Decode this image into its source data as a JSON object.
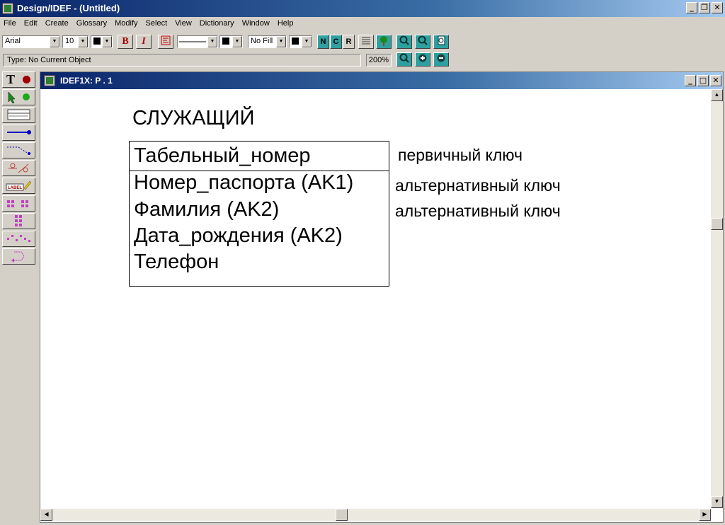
{
  "app": {
    "title": "Design/IDEF - (Untitled)"
  },
  "window_buttons": {
    "minimize": "_",
    "restore": "❐",
    "close": "✕"
  },
  "menu": [
    "File",
    "Edit",
    "Create",
    "Glossary",
    "Modify",
    "Select",
    "View",
    "Dictionary",
    "Window",
    "Help"
  ],
  "toolbar": {
    "font": "Arial",
    "size": "10",
    "bold": "B",
    "italic": "I",
    "fill": "No Fill",
    "n_label": "N",
    "c_label": "C",
    "r_label": "R"
  },
  "status": {
    "type_text": "Type: No Current Object",
    "zoom": "200%"
  },
  "palette": {
    "text_tool": "T"
  },
  "child_window": {
    "title": "IDEF1X:   P . 1"
  },
  "entity": {
    "name": "СЛУЖАЩИЙ",
    "key_attribute": "Табельный_номер",
    "attributes": [
      "Номер_паспорта (AK1)",
      "Фамилия (AK2)",
      "Дата_рождения (AK2)",
      "Телефон"
    ]
  },
  "notes": {
    "primary": "первичный ключ",
    "alt1": "альтернативный ключ",
    "alt2": "альтернативный ключ"
  },
  "colors": {
    "title_bar": "#0a246a",
    "face": "#d4d0c8",
    "teal_button": "#2fa0a0"
  }
}
